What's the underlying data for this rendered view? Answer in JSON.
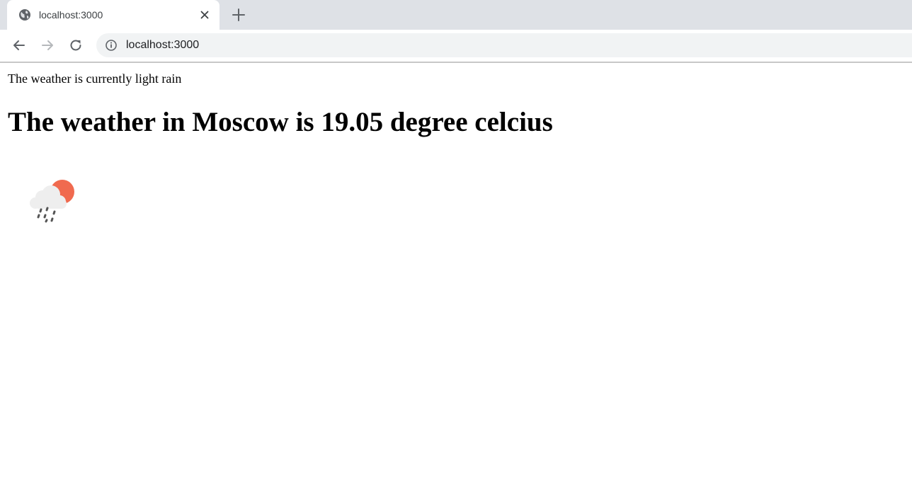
{
  "browser": {
    "tab": {
      "title": "localhost:3000",
      "favicon": "globe-icon"
    },
    "omnibox": {
      "url": "localhost:3000",
      "icon": "info-icon"
    },
    "nav": {
      "back_icon": "arrow-left-icon",
      "forward_icon": "arrow-right-icon",
      "reload_icon": "reload-icon"
    }
  },
  "page": {
    "status_text": "The weather is currently light rain",
    "headline": "The weather in Moscow is 19.05 degree celcius",
    "weather_icon": "light-rain-icon"
  },
  "colors": {
    "sun": "#f06a4f",
    "cloud": "#eeeeee",
    "rain": "#555555",
    "tabstrip": "#dee1e6",
    "omnibox": "#f1f3f4"
  }
}
